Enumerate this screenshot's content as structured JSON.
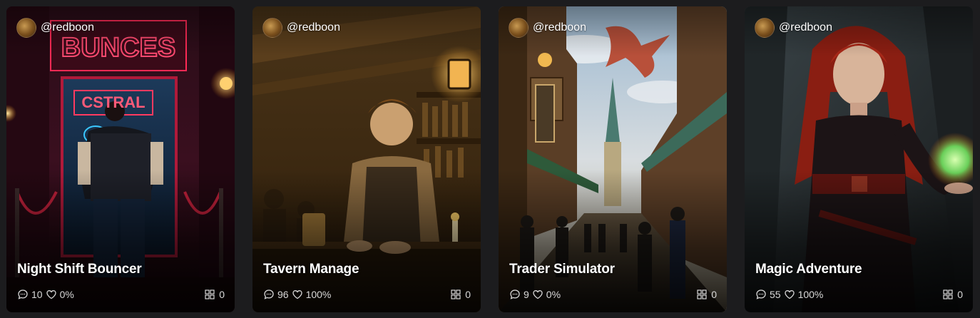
{
  "cards": [
    {
      "author": "@redboon",
      "title": "Night Shift Bouncer",
      "comments": "10",
      "likes": "0%",
      "forks": "0",
      "sign_text": "BUNCES",
      "sign2_text": "CSTRAL",
      "colors": {
        "accent": "#ff2a55"
      }
    },
    {
      "author": "@redboon",
      "title": "Tavern Manage",
      "comments": "96",
      "likes": "100%",
      "forks": "0",
      "colors": {
        "accent": "#e0a040"
      }
    },
    {
      "author": "@redboon",
      "title": "Trader Simulator",
      "comments": "9",
      "likes": "0%",
      "forks": "0",
      "colors": {
        "accent": "#c9a66b"
      }
    },
    {
      "author": "@redboon",
      "title": "Magic Adventure",
      "comments": "55",
      "likes": "100%",
      "forks": "0",
      "colors": {
        "accent": "#7fe07a"
      }
    }
  ],
  "icons": {
    "avatar": "avatar-image",
    "comments": "comment-bubble-icon",
    "likes": "heart-icon",
    "forks": "grid-icon"
  }
}
